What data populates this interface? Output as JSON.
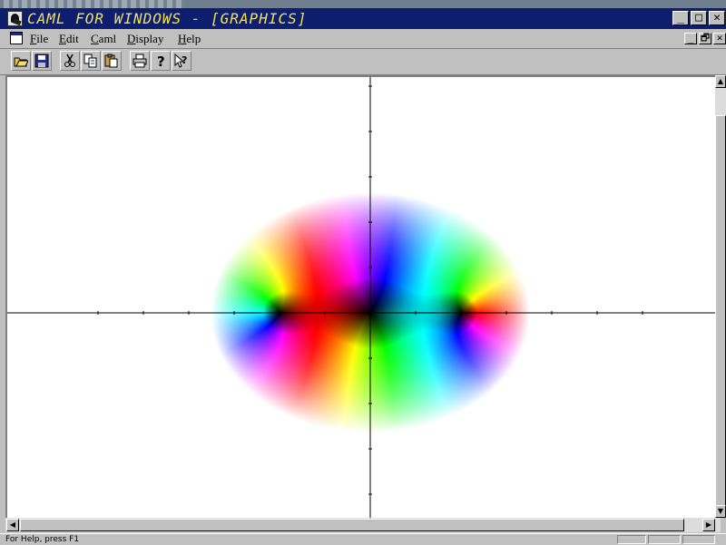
{
  "window": {
    "title": "CAML FOR WINDOWS - [GRAPHICS]",
    "controls": [
      "_",
      "□",
      "✕"
    ],
    "title_color": "#0d1e6e",
    "title_text_color": "#f2e05a"
  },
  "menubar": {
    "items": [
      "File",
      "Edit",
      "Caml",
      "Display",
      "Help"
    ],
    "mdi_controls": [
      "_",
      "🗗",
      "✕"
    ]
  },
  "toolbar": {
    "tools": [
      "open-icon",
      "save-icon",
      "cut-icon",
      "copy-icon",
      "paste-icon",
      "print-icon",
      "help-icon",
      "context-help-icon"
    ]
  },
  "graphics": {
    "description_colors": {
      "axis": "#000000",
      "background": "#ffffff"
    },
    "zeros": [
      -1,
      0,
      1
    ],
    "pole": "none",
    "domain": [
      -2,
      2
    ]
  },
  "statusbar": {
    "text": "For Help, press F1"
  }
}
